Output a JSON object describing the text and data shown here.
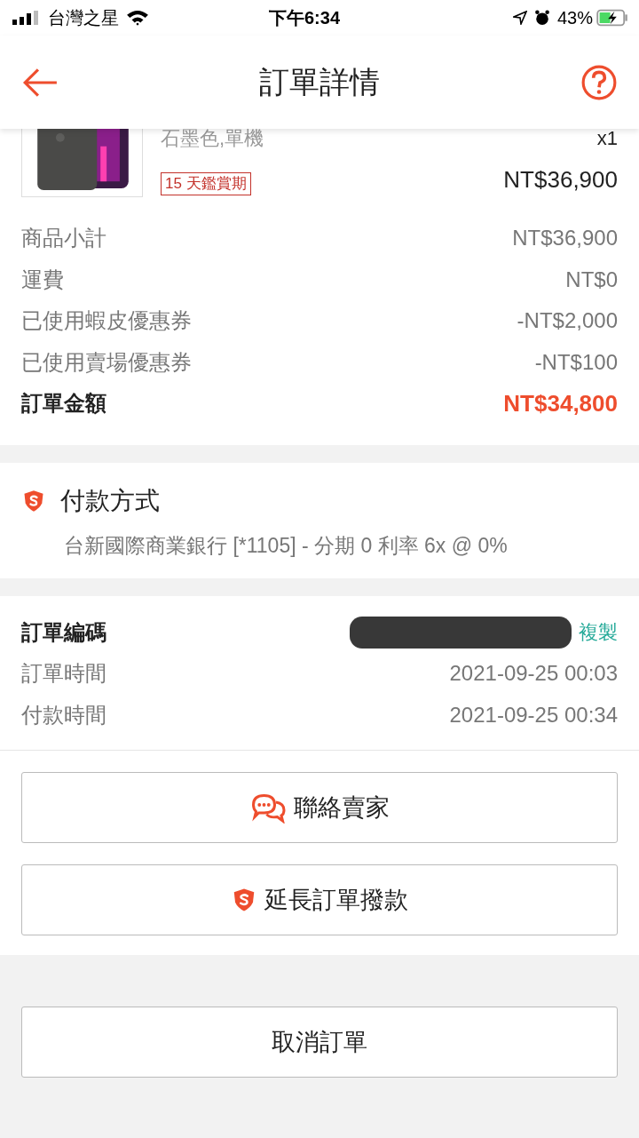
{
  "status_bar": {
    "carrier": "台灣之星",
    "time": "下午6:34",
    "battery": "43%"
  },
  "header": {
    "title": "訂單詳情"
  },
  "product": {
    "kind": "picture",
    "variant": "石墨色,單機",
    "quantity": "x1",
    "badge": "15 天鑑賞期",
    "price": "NT$36,900"
  },
  "summary": [
    {
      "label": "商品小計",
      "value": "NT$36,900",
      "total": false
    },
    {
      "label": "運費",
      "value": "NT$0",
      "total": false
    },
    {
      "label": "已使用蝦皮優惠券",
      "value": "-NT$2,000",
      "total": false
    },
    {
      "label": "已使用賣場優惠券",
      "value": "-NT$100",
      "total": false
    },
    {
      "label": "訂單金額",
      "value": "NT$34,800",
      "total": true
    }
  ],
  "payment": {
    "title": "付款方式",
    "detail": "台新國際商業銀行 [*1105] - 分期 0 利率 6x @ 0%"
  },
  "order_info": [
    {
      "label": "訂單編碼",
      "kind": "redacted",
      "action": "複製"
    },
    {
      "label": "訂單時間",
      "kind": "text",
      "value": "2021-09-25 00:03"
    },
    {
      "label": "付款時間",
      "kind": "text",
      "value": "2021-09-25 00:34"
    }
  ],
  "actions": [
    {
      "label": "聯絡賣家",
      "kind": "chat"
    },
    {
      "label": "延長訂單撥款",
      "kind": "shield"
    }
  ],
  "cancel_button": "取消訂單"
}
